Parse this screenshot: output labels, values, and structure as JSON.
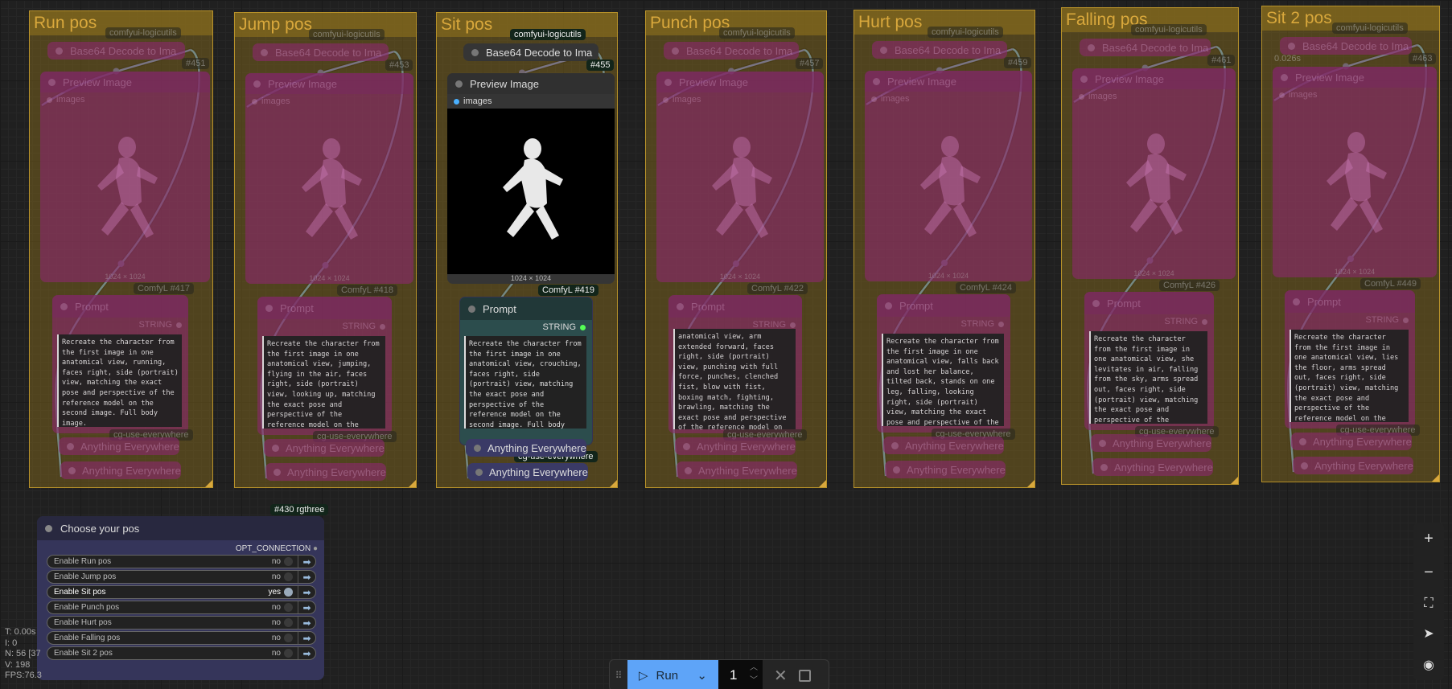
{
  "groups": [
    {
      "title": "Run pos",
      "logic_badge": "comfyui-logicutils",
      "base64_label": "Base64 Decode to Ima",
      "base64_id": "#451",
      "preview_label": "Preview Image",
      "images_label": "images",
      "size_label": "1024 × 1024",
      "comfy_badge": "ComfyL",
      "prompt_id": "#417",
      "prompt_title": "Prompt",
      "string_label": "STRING",
      "prompt_text": "Recreate the character from the first image in one anatomical view, running, faces right, side (portrait) view, matching the exact pose and perspective of the reference model on the second image. Full body image.",
      "cg_badge": "cg-use-everywhere",
      "anything": [
        "Anything Everywhere",
        "Anything Everywhere"
      ]
    },
    {
      "title": "Jump pos",
      "logic_badge": "comfyui-logicutils",
      "base64_label": "Base64 Decode to Ima",
      "base64_id": "#453",
      "preview_label": "Preview Image",
      "images_label": "images",
      "size_label": "1024 × 1024",
      "comfy_badge": "ComfyL",
      "prompt_id": "#418",
      "prompt_title": "Prompt",
      "string_label": "STRING",
      "prompt_text": "Recreate the character from the first image in one anatomical view, jumping, flying in the air, faces right, side (portrait) view, looking up, matching the exact pose and perspective of the reference model on the second image. Full body image.",
      "cg_badge": "cg-use-everywhere",
      "anything": [
        "Anything Everywhere",
        "Anything Everywhere"
      ]
    },
    {
      "title": "Sit pos",
      "logic_badge": "comfyui-logicutils",
      "base64_label": "Base64 Decode to Ima",
      "base64_id": "#455",
      "preview_label": "Preview Image",
      "images_label": "images",
      "size_label": "1024 × 1024",
      "comfy_badge": "ComfyL",
      "prompt_id": "#419",
      "prompt_title": "Prompt",
      "string_label": "STRING",
      "prompt_text": "Recreate the character from the first image in one anatomical view, crouching, faces right, side (portrait) view, matching the exact pose and perspective of the reference model on the second image. Full body image.",
      "cg_badge": "cg-use-everywhere",
      "anything": [
        "Anything Everywhere",
        "Anything Everywhere"
      ]
    },
    {
      "title": "Punch pos",
      "logic_badge": "comfyui-logicutils",
      "base64_label": "Base64 Decode to Ima",
      "base64_id": "#457",
      "preview_label": "Preview Image",
      "images_label": "images",
      "size_label": "1024 × 1024",
      "comfy_badge": "ComfyL",
      "prompt_id": "#422",
      "prompt_title": "Prompt",
      "string_label": "STRING",
      "prompt_text": "anatomical view, arm extended forward, faces right, side (portrait) view, punching with full force, punches, clenched fist, blow with fist, boxing match, fighting, brawling, matching the exact pose and perspective of the reference model on the second image. Full body image.",
      "cg_badge": "cg-use-everywhere",
      "anything": [
        "Anything Everywhere",
        "Anything Everywhere"
      ]
    },
    {
      "title": "Hurt pos",
      "logic_badge": "comfyui-logicutils",
      "base64_label": "Base64 Decode to Ima",
      "base64_id": "#459",
      "preview_label": "Preview Image",
      "images_label": "images",
      "size_label": "1024 × 1024",
      "comfy_badge": "ComfyL",
      "prompt_id": "#424",
      "prompt_title": "Prompt",
      "string_label": "STRING",
      "prompt_text": "Recreate the character from the first image in one anatomical view, falls back and lost her balance, tilted back, stands on one leg, falling, looking right, side (portrait) view, matching the exact pose and perspective of the reference model on the second image. Full body image.",
      "cg_badge": "cg-use-everywhere",
      "anything": [
        "Anything Everywhere",
        "Anything Everywhere"
      ]
    },
    {
      "title": "Falling pos",
      "logic_badge": "comfyui-logicutils",
      "base64_label": "Base64 Decode to Ima",
      "base64_id": "#461",
      "preview_label": "Preview Image",
      "images_label": "images",
      "size_label": "1024 × 1024",
      "comfy_badge": "ComfyL",
      "prompt_id": "#426",
      "prompt_title": "Prompt",
      "string_label": "STRING",
      "prompt_text": "Recreate the character from the first image in one anatomical view, she levitates in air, falling from the sky, arms spread out, faces right, side (portrait) view, matching the exact pose and perspective of the reference model on the second image. Full body image.",
      "cg_badge": "cg-use-everywhere",
      "anything": [
        "Anything Everywhere",
        "Anything Everywhere"
      ]
    },
    {
      "title": "Sit 2 pos",
      "logic_badge": "comfyui-logicutils",
      "base64_label": "Base64 Decode to Ima",
      "base64_id": "#463",
      "preview_label": "Preview Image",
      "images_label": "images",
      "size_label": "1024 × 1024",
      "comfy_badge": "ComfyL",
      "prompt_id": "#449",
      "prompt_title": "Prompt",
      "string_label": "STRING",
      "prompt_text": "Recreate the character from the first image in one anatomical view, lies the floor, arms spread out, faces right, side (portrait) view, matching the exact pose and perspective of the reference model on the second image. Full body image.",
      "cg_badge": "cg-use-everywhere",
      "anything": [
        "Anything Everywhere",
        "Anything Everywhere"
      ],
      "timing": "0.026s"
    }
  ],
  "chooser": {
    "badge": "#430 rgthree",
    "title": "Choose your pos",
    "output": "OPT_CONNECTION",
    "rows": [
      {
        "label": "Enable Run pos",
        "value": "no",
        "on": false
      },
      {
        "label": "Enable Jump pos",
        "value": "no",
        "on": false
      },
      {
        "label": "Enable Sit pos",
        "value": "yes",
        "on": true
      },
      {
        "label": "Enable Punch pos",
        "value": "no",
        "on": false
      },
      {
        "label": "Enable Hurt pos",
        "value": "no",
        "on": false
      },
      {
        "label": "Enable Falling pos",
        "value": "no",
        "on": false
      },
      {
        "label": "Enable Sit 2 pos",
        "value": "no",
        "on": false
      }
    ]
  },
  "stats": [
    "T: 0.00s",
    "I: 0",
    "N: 56 [37",
    "V: 198",
    "FPS:76.3"
  ],
  "toolbar": {
    "run_label": "Run",
    "queue_count": "1"
  },
  "colors": {
    "accent": "#5ea4f8",
    "group_title": "#d9a83c",
    "wire": "#6fb8ff"
  }
}
